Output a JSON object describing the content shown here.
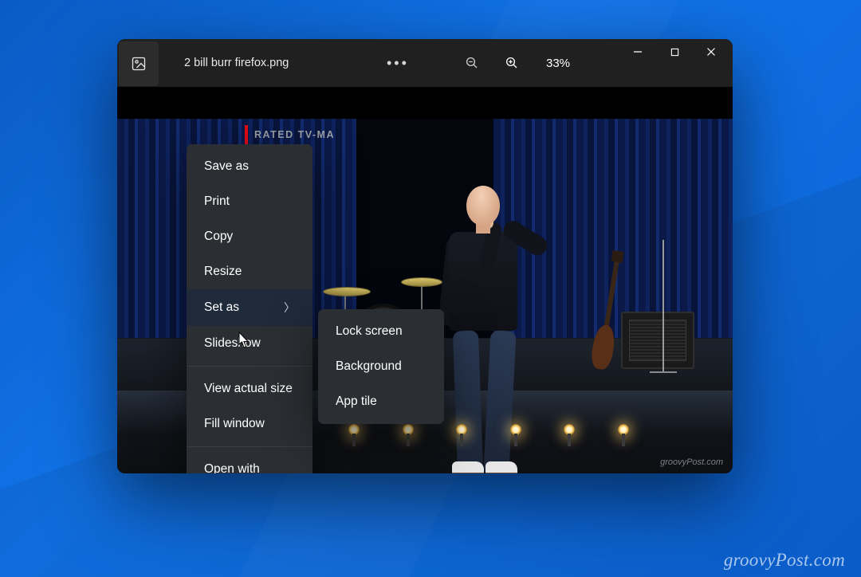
{
  "titlebar": {
    "filename": "2 bill burr firefox.png",
    "zoom_level": "33%"
  },
  "rating_label": "RATED TV-MA",
  "image_watermark": "groovyPost.com",
  "context_menu": {
    "items": [
      {
        "label": "Save as",
        "has_submenu": false
      },
      {
        "label": "Print",
        "has_submenu": false
      },
      {
        "label": "Copy",
        "has_submenu": false
      },
      {
        "label": "Resize",
        "has_submenu": false
      },
      {
        "label": "Set as",
        "has_submenu": true,
        "hovered": true
      },
      {
        "label": "Slideshow",
        "has_submenu": false
      },
      {
        "sep": true
      },
      {
        "label": "View actual size",
        "has_submenu": false
      },
      {
        "label": "Fill window",
        "has_submenu": false
      },
      {
        "sep": true
      },
      {
        "label": "Open with",
        "has_submenu": false
      }
    ],
    "submenu": [
      {
        "label": "Lock screen"
      },
      {
        "label": "Background"
      },
      {
        "label": "App tile"
      }
    ]
  },
  "site_watermark": "groovyPost.com"
}
